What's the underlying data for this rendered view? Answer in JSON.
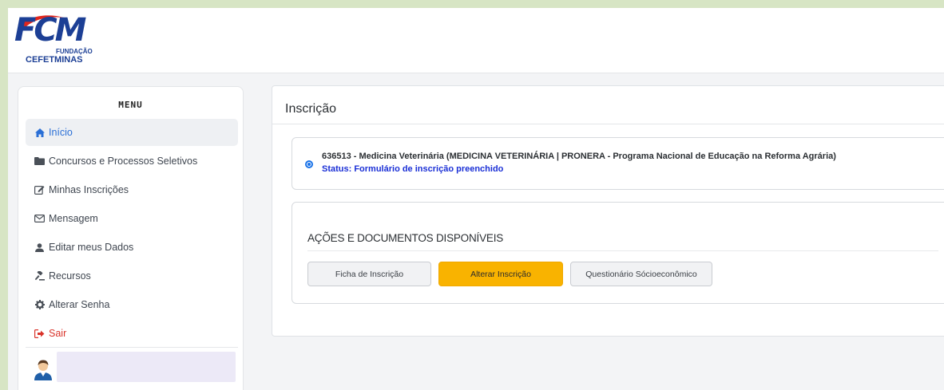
{
  "logo": {
    "main": "FCM",
    "line1": "FUNDAÇÃO",
    "line2": "CEFETMINAS",
    "brand_color": "#1c3f95",
    "accent_color": "#e1261c"
  },
  "sidebar": {
    "title": "MENU",
    "items": [
      {
        "label": "Início",
        "icon": "home-icon",
        "active": true
      },
      {
        "label": "Concursos e Processos Seletivos",
        "icon": "folder-icon"
      },
      {
        "label": "Minhas Inscrições",
        "icon": "edit-icon"
      },
      {
        "label": "Mensagem",
        "icon": "envelope-icon"
      },
      {
        "label": "Editar meus Dados",
        "icon": "user-icon"
      },
      {
        "label": "Recursos",
        "icon": "gavel-icon"
      },
      {
        "label": "Alterar Senha",
        "icon": "gear-icon"
      },
      {
        "label": "Sair",
        "icon": "sign-out-icon"
      }
    ]
  },
  "main": {
    "title": "Inscrição",
    "inscricao": {
      "title": "636513 - Medicina Veterinária (MEDICINA VETERINÁRIA | PRONERA - Programa Nacional de Educação na Reforma Agrária)",
      "status": "Status: Formulário de inscrição preenchido",
      "selected": true
    },
    "acoes": {
      "title": "AÇÕES E DOCUMENTOS DISPONÍVEIS",
      "buttons": {
        "ficha": "Ficha de Inscrição",
        "alterar": "Alterar Inscrição",
        "questionario": "Questionário Sócioeconômico"
      }
    }
  },
  "colors": {
    "background": "#d7e5c4",
    "active_link": "#2a6fd6",
    "logout": "#d9342b",
    "status": "#1a2fd6",
    "primary_button": "#f9b300"
  }
}
